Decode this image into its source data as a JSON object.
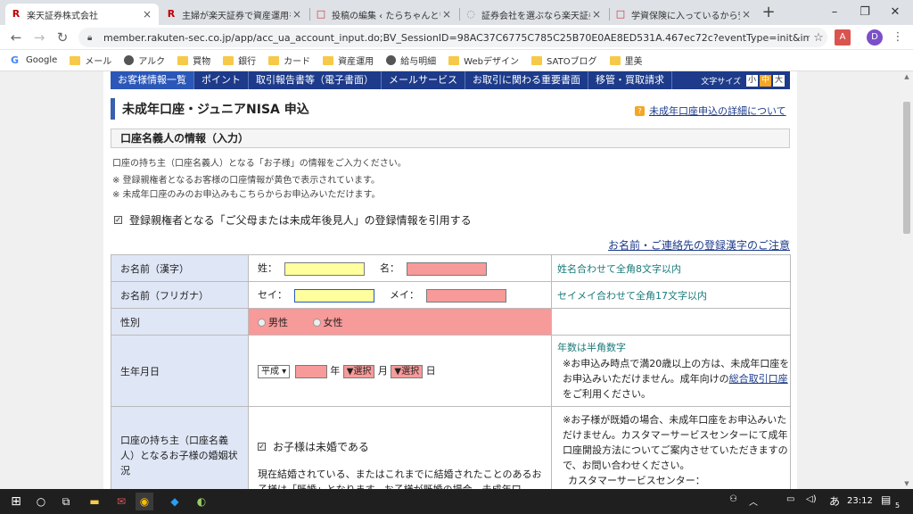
{
  "browser": {
    "tabs": [
      {
        "icon": "R",
        "label": "楽天証券株式会社"
      },
      {
        "icon": "R",
        "label": "主婦が楽天証券で資産運用を"
      },
      {
        "icon": "□",
        "label": "投稿の編集 ‹ たらちゃんといく"
      },
      {
        "icon": "◌",
        "label": "証券会社を選ぶなら楽天証券"
      },
      {
        "icon": "□",
        "label": "学資保険に入っているから安心"
      }
    ],
    "url": "member.rakuten-sec.co.jp/app/acc_ua_account_input.do;BV_SessionID=98AC37C6775C785C25B70E0AE8ED531A.467ec72c?eventType=init&important_info_c...",
    "profile_initial": "D",
    "bookmarks": [
      "Google",
      "メール",
      "アルク",
      "買物",
      "銀行",
      "カード",
      "資産運用",
      "給与明細",
      "Webデザイン",
      "SATOブログ",
      "里美"
    ]
  },
  "nav": {
    "items": [
      "お客様情報一覧",
      "ポイント",
      "取引報告書等（電子書面）",
      "メールサービス",
      "お取引に関わる重要書面",
      "移管・買取請求"
    ],
    "font_size_label": "文字サイズ",
    "font_sizes": [
      "小",
      "中",
      "大"
    ]
  },
  "page": {
    "title": "未成年口座・ジュニアNISA 申込",
    "detail_link": "未成年口座申込の詳細について",
    "section_title": "口座名義人の情報（入力）",
    "notes": [
      "口座の持ち主（口座名義人）となる「お子様」の情報をご入力ください。",
      "※  登録親権者となるお客様の口座情報が黄色で表示されています。",
      "※  未成年口座のみのお申込みもこちらからお申込みいただけます。"
    ],
    "quote_checkbox": "登録親権者となる「ご父母または未成年後見人」の登録情報を引用する",
    "kanji_link": "お名前・ご連絡先の登録漢字のご注意"
  },
  "form": {
    "name_kanji": {
      "label": "お名前（漢字）",
      "sei": "姓：",
      "mei": "名：",
      "hint": "姓名合わせて全角8文字以内"
    },
    "name_kana": {
      "label": "お名前（フリガナ）",
      "sei": "セイ：",
      "mei": "メイ：",
      "hint": "セイメイ合わせて全角17文字以内"
    },
    "gender": {
      "label": "性別",
      "male": "男性",
      "female": "女性"
    },
    "birth": {
      "label": "生年月日",
      "era": "平成",
      "year": "年",
      "select1": "▼選択",
      "month": "月",
      "select2": "▼選択",
      "day": "日",
      "hint_title": "年数は半角数字",
      "hint_1": "※お申込み時点で満20歳以上の方は、未成年口座をお申込みいただけません。成年向けの",
      "hint_link": "総合取引口座",
      "hint_2": "をご利用ください。"
    },
    "marriage": {
      "label": "口座の持ち主（口座名義人）となるお子様の婚姻状況",
      "checkbox": "お子様は未婚である",
      "desc": "現在結婚されている、またはこれまでに結婚されたことのあるお子様は「既婚」となります。お子様が既婚の場合、未成年口",
      "hint": "※お子様が既婚の場合、未成年口座をお申込みいただけません。カスタマーサービスセンターにて成年口座開設方法についてご案内させていただきますので、お問い合わせください。",
      "hint_2": "カスタマーサービスセンター："
    }
  },
  "taskbar": {
    "time": "23:12",
    "ime": "あ",
    "notif_count": "5"
  }
}
